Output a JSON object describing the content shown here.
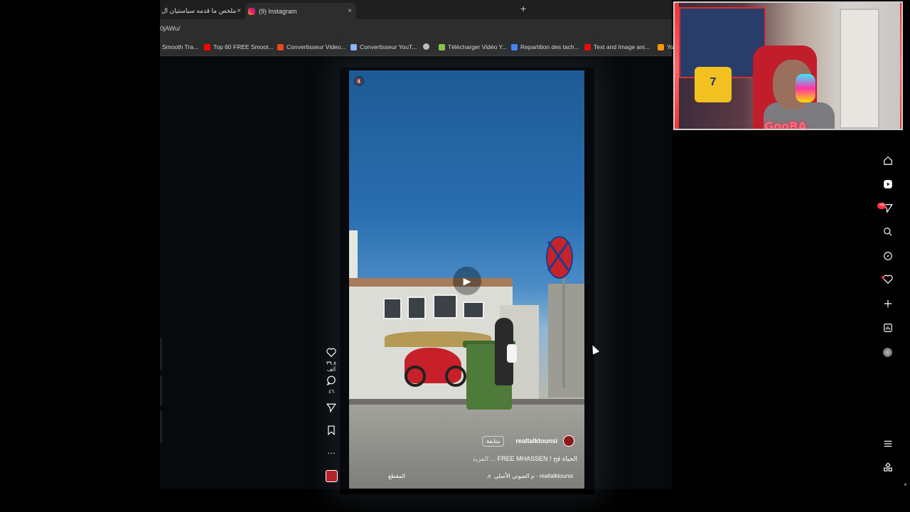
{
  "browser": {
    "tabs": [
      {
        "label": "ملخص ما قدمه سياستيان ال",
        "close": "×"
      },
      {
        "label": "(9) Instagram",
        "close": "×"
      }
    ],
    "new_tab": "+",
    "url": "0jAWu/",
    "bookmarks": [
      {
        "label": "Smooth Tra...",
        "icon": "page-icon",
        "color": "#9aa0a6"
      },
      {
        "label": "Top 60 FREE Smoot...",
        "icon": "youtube-icon",
        "color": "#ff0000"
      },
      {
        "label": "Convertisseur Video...",
        "icon": "z-icon",
        "color": "#e64a19"
      },
      {
        "label": "Convertisseur YouT...",
        "icon": "converter-icon",
        "color": "#8ab4f8"
      },
      {
        "label": "",
        "icon": "globe-icon",
        "color": "#bdbdbd"
      },
      {
        "label": "Télécharger Vidéo Y...",
        "icon": "download-icon",
        "color": "#8bc34a"
      },
      {
        "label": "Repartition des tach...",
        "icon": "docs-icon",
        "color": "#4285f4"
      },
      {
        "label": "Text and Image ani...",
        "icon": "youtube-icon",
        "color": "#ff0000"
      },
      {
        "label": "Yo",
        "icon": "sparkle-icon",
        "color": "#ff9800"
      }
    ]
  },
  "reel": {
    "username": "realtalktounsi",
    "follow_label": "متابعة",
    "caption": "الحياة قح ! FREE MHASSEN ...",
    "more_label": "المزيد",
    "audio": "♬ م الصوتي الأصلي · realtalktounsi",
    "clip_label": "المقطع",
    "play_glyph": "▶",
    "mute_glyph": "🔇"
  },
  "actions": {
    "likes": "٣٩.٨ ألف",
    "comments": "٤٦",
    "more": "…"
  },
  "nav": {
    "notification_badge": "+9"
  },
  "webcam": {
    "neon_text": "GooBA",
    "jersey_number": "7"
  },
  "colors": {
    "badge": "#ff3040",
    "accent": "#c6242a"
  }
}
